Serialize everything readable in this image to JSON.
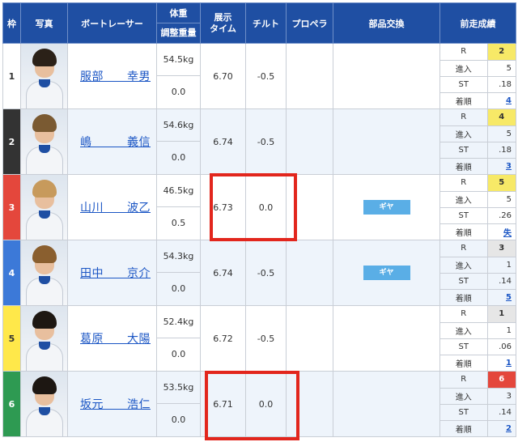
{
  "headers": {
    "frame": "枠",
    "photo": "写真",
    "racer": "ボートレーサー",
    "weight_top": "体重",
    "weight_bottom": "調整重量",
    "exhibit_line1": "展示",
    "exhibit_line2": "タイム",
    "tilt": "チルト",
    "propeller": "プロペラ",
    "parts": "部品交換",
    "prev": "前走成績"
  },
  "row_colors": [
    "#ffffff",
    "#333333",
    "#e4473c",
    "#3c79d8",
    "#ffe84a",
    "#2e9a52"
  ],
  "row_text_colors": [
    "#333333",
    "#ffffff",
    "#ffffff",
    "#ffffff",
    "#333333",
    "#ffffff"
  ],
  "row_bg": [
    "#ffffff",
    "#eef4fb",
    "#ffffff",
    "#eef4fb",
    "#ffffff",
    "#eef4fb"
  ],
  "racers": [
    {
      "frame": "1",
      "name": "服部　　幸男",
      "weight": "54.5kg",
      "adjust": "0.0",
      "exhibit": "6.70",
      "tilt": "-0.5",
      "propeller": "",
      "parts": "",
      "prev": {
        "r_label": "R",
        "r": "2",
        "r_color": "#f7e967",
        "entry_label": "進入",
        "entry": "5",
        "st_label": "ST",
        "st": ".18",
        "finish_label": "着順",
        "finish": "4"
      }
    },
    {
      "frame": "2",
      "name": "嶋　　　義信",
      "weight": "54.6kg",
      "adjust": "0.0",
      "exhibit": "6.74",
      "tilt": "-0.5",
      "propeller": "",
      "parts": "",
      "prev": {
        "r_label": "R",
        "r": "4",
        "r_color": "#f7e967",
        "entry_label": "進入",
        "entry": "5",
        "st_label": "ST",
        "st": ".18",
        "finish_label": "着順",
        "finish": "3"
      }
    },
    {
      "frame": "3",
      "name": "山川　　波乙",
      "weight": "46.5kg",
      "adjust": "0.5",
      "exhibit": "6.73",
      "tilt": "0.0",
      "propeller": "",
      "parts": "ギヤ",
      "prev": {
        "r_label": "R",
        "r": "5",
        "r_color": "#f7e967",
        "entry_label": "進入",
        "entry": "5",
        "st_label": "ST",
        "st": ".26",
        "finish_label": "着順",
        "finish": "失"
      }
    },
    {
      "frame": "4",
      "name": "田中　　京介",
      "weight": "54.3kg",
      "adjust": "0.0",
      "exhibit": "6.74",
      "tilt": "-0.5",
      "propeller": "",
      "parts": "ギヤ",
      "prev": {
        "r_label": "R",
        "r": "3",
        "r_color": "#e6e6e6",
        "entry_label": "進入",
        "entry": "1",
        "st_label": "ST",
        "st": ".14",
        "finish_label": "着順",
        "finish": "5"
      }
    },
    {
      "frame": "5",
      "name": "葛原　　大陽",
      "weight": "52.4kg",
      "adjust": "0.0",
      "exhibit": "6.72",
      "tilt": "-0.5",
      "propeller": "",
      "parts": "",
      "prev": {
        "r_label": "R",
        "r": "1",
        "r_color": "#e6e6e6",
        "entry_label": "進入",
        "entry": "1",
        "st_label": "ST",
        "st": ".06",
        "finish_label": "着順",
        "finish": "1"
      }
    },
    {
      "frame": "6",
      "name": "坂元　　浩仁",
      "weight": "53.5kg",
      "adjust": "0.0",
      "exhibit": "6.71",
      "tilt": "0.0",
      "propeller": "",
      "parts": "",
      "prev": {
        "r_label": "R",
        "r": "6",
        "r_color": "#e4473c",
        "entry_label": "進入",
        "entry": "3",
        "st_label": "ST",
        "st": ".14",
        "finish_label": "着順",
        "finish": "2"
      }
    }
  ],
  "hair_colors": [
    "#2b2118",
    "#7a5a32",
    "#c79a5c",
    "#8a5f2f",
    "#1d1712",
    "#1d1712"
  ],
  "highlight_color": "#e2261d"
}
